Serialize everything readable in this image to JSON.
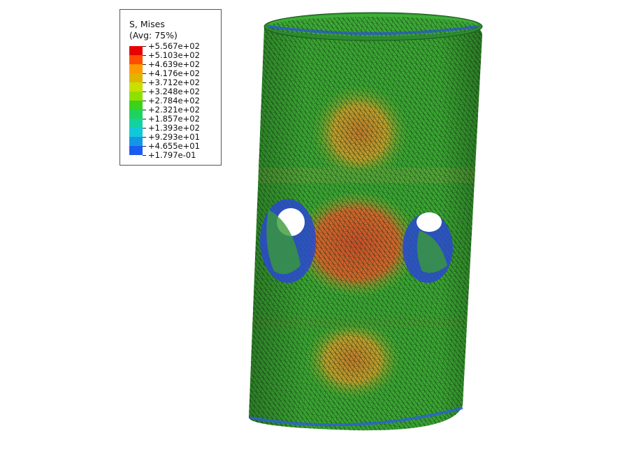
{
  "legend": {
    "title": "S, Mises",
    "subtitle": "(Avg: 75%)",
    "values": [
      "+5.567e+02",
      "+5.103e+02",
      "+4.639e+02",
      "+4.176e+02",
      "+3.712e+02",
      "+3.248e+02",
      "+2.784e+02",
      "+2.321e+02",
      "+1.857e+02",
      "+1.393e+02",
      "+9.293e+01",
      "+4.655e+01",
      "+1.797e-01"
    ],
    "colors": [
      "#e60000",
      "#ff4d00",
      "#ff9900",
      "#e0b400",
      "#c8e000",
      "#8fe000",
      "#3ad21a",
      "#1ed25e",
      "#14d2a0",
      "#10c8d8",
      "#1496e6",
      "#1a5cf0",
      "#0a14c8"
    ]
  },
  "model": {
    "name": "cylinder-stress-mesh",
    "base_color": "#3aa832",
    "mesh_color": "#1a3a1a",
    "hot_color": "#d2522a",
    "warm_color": "#c8a020",
    "cold_color": "#2a4ad6"
  }
}
